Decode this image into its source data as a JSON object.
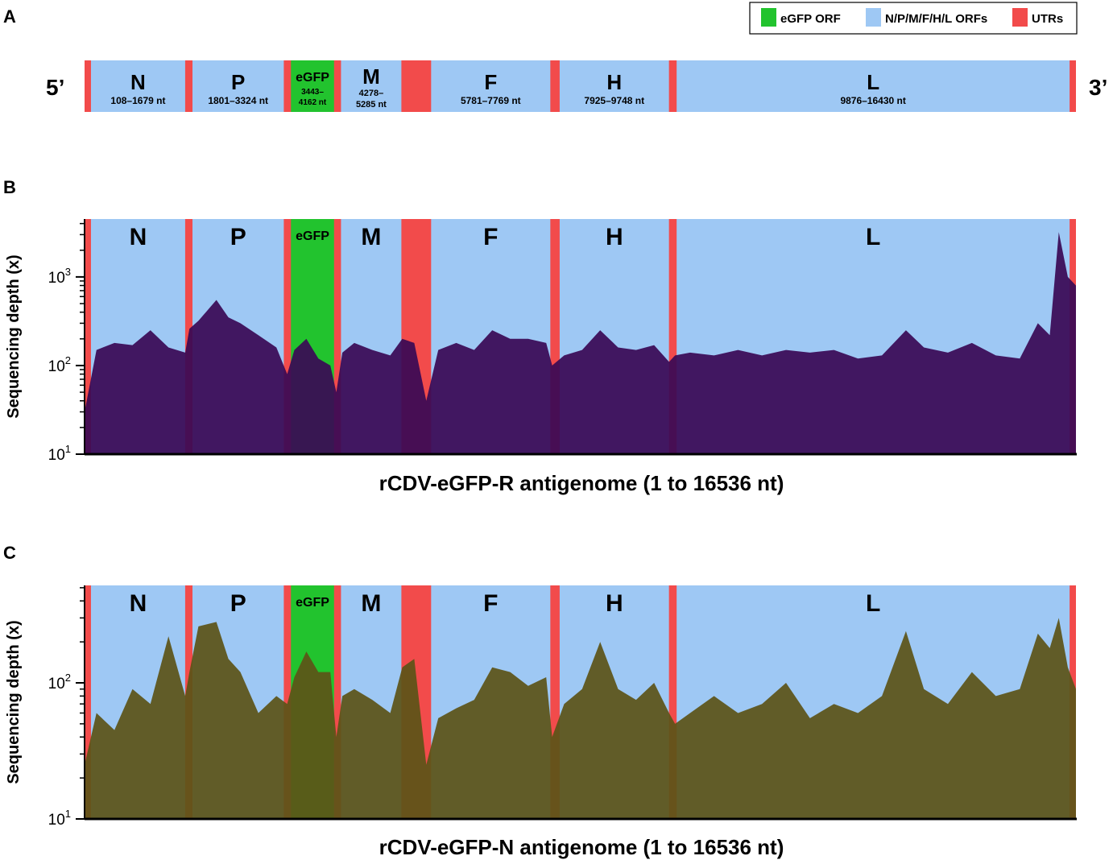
{
  "panels": {
    "a": "A",
    "b": "B",
    "c": "C"
  },
  "legend": {
    "items": [
      {
        "label": "eGFP ORF",
        "color": "#22c32e"
      },
      {
        "label": "N/P/M/F/H/L ORFs",
        "color": "#9ec8f4"
      },
      {
        "label": "UTRs",
        "color": "#f24b4b"
      }
    ]
  },
  "colors": {
    "orf": "#9ec8f4",
    "egfp": "#22c32e",
    "utr": "#f24b4b",
    "depth_r": "#3a0a55",
    "depth_n": "#5c5418"
  },
  "genome": {
    "five_prime": "5’",
    "three_prime": "3’",
    "length": 16536,
    "genes": [
      {
        "name": "N",
        "range": "108–1679 nt",
        "start": 108,
        "end": 1679
      },
      {
        "name": "P",
        "range": "1801–3324 nt",
        "start": 1801,
        "end": 3324
      },
      {
        "name": "eGFP",
        "range_line1": "3443–",
        "range_line2": "4162 nt",
        "start": 3443,
        "end": 4162,
        "egfp": true
      },
      {
        "name": "M",
        "range_line1": "4278–",
        "range_line2": "5285 nt",
        "start": 4278,
        "end": 5285
      },
      {
        "name": "F",
        "range": "5781–7769 nt",
        "start": 5781,
        "end": 7769
      },
      {
        "name": "H",
        "range": "7925–9748 nt",
        "start": 7925,
        "end": 9748
      },
      {
        "name": "L",
        "range": "9876–16430 nt",
        "start": 9876,
        "end": 16430
      }
    ]
  },
  "chart_data": [
    {
      "type": "area",
      "panel": "B",
      "xlabel": "rCDV-eGFP-R antigenome (1 to 16536 nt)",
      "ylabel": "Sequencing depth (x)",
      "yscale": "log",
      "xlim": [
        1,
        16536
      ],
      "ylim": [
        10,
        4500
      ],
      "yticks": [
        {
          "value": 10,
          "base": "10",
          "exp": "1"
        },
        {
          "value": 100,
          "base": "10",
          "exp": "2"
        },
        {
          "value": 1000,
          "base": "10",
          "exp": "3"
        }
      ],
      "x": [
        1,
        200,
        500,
        800,
        1100,
        1400,
        1680,
        1750,
        1900,
        2200,
        2400,
        2600,
        2900,
        3200,
        3380,
        3500,
        3700,
        3900,
        4100,
        4200,
        4300,
        4500,
        4800,
        5100,
        5300,
        5500,
        5700,
        5900,
        6200,
        6500,
        6800,
        7100,
        7400,
        7700,
        7800,
        8000,
        8300,
        8600,
        8900,
        9200,
        9500,
        9750,
        9850,
        10100,
        10500,
        10900,
        11300,
        11700,
        12100,
        12500,
        12900,
        13300,
        13700,
        14000,
        14400,
        14800,
        15200,
        15600,
        15900,
        16100,
        16250,
        16400,
        16536
      ],
      "values": [
        30,
        150,
        180,
        170,
        250,
        160,
        140,
        260,
        320,
        550,
        350,
        300,
        220,
        160,
        80,
        150,
        200,
        120,
        100,
        50,
        140,
        180,
        150,
        130,
        200,
        180,
        40,
        150,
        180,
        150,
        250,
        200,
        200,
        180,
        100,
        130,
        150,
        250,
        160,
        150,
        170,
        110,
        130,
        140,
        130,
        150,
        130,
        150,
        140,
        150,
        120,
        130,
        250,
        160,
        140,
        180,
        130,
        120,
        300,
        220,
        3200,
        1000,
        800
      ]
    },
    {
      "type": "area",
      "panel": "C",
      "xlabel": "rCDV-eGFP-N antigenome (1 to 16536 nt)",
      "ylabel": "Sequencing depth (x)",
      "yscale": "log",
      "xlim": [
        1,
        16536
      ],
      "ylim": [
        10,
        520
      ],
      "yticks": [
        {
          "value": 10,
          "base": "10",
          "exp": "1"
        },
        {
          "value": 100,
          "base": "10",
          "exp": "2"
        }
      ],
      "x": [
        1,
        200,
        500,
        800,
        1100,
        1400,
        1680,
        1750,
        1900,
        2200,
        2400,
        2600,
        2900,
        3200,
        3380,
        3500,
        3700,
        3900,
        4100,
        4200,
        4300,
        4500,
        4800,
        5100,
        5300,
        5500,
        5700,
        5900,
        6200,
        6500,
        6800,
        7100,
        7400,
        7700,
        7800,
        8000,
        8300,
        8600,
        8900,
        9200,
        9500,
        9750,
        9850,
        10100,
        10500,
        10900,
        11300,
        11700,
        12100,
        12500,
        12900,
        13300,
        13700,
        14000,
        14400,
        14800,
        15200,
        15600,
        15900,
        16100,
        16250,
        16400,
        16536
      ],
      "values": [
        25,
        60,
        45,
        90,
        70,
        220,
        80,
        120,
        260,
        280,
        150,
        120,
        60,
        80,
        70,
        110,
        170,
        120,
        120,
        40,
        80,
        90,
        75,
        60,
        130,
        150,
        25,
        55,
        65,
        75,
        130,
        120,
        95,
        110,
        40,
        70,
        90,
        200,
        90,
        75,
        100,
        60,
        50,
        60,
        80,
        60,
        70,
        100,
        55,
        70,
        60,
        80,
        240,
        90,
        70,
        120,
        80,
        90,
        230,
        180,
        300,
        130,
        90
      ]
    }
  ]
}
